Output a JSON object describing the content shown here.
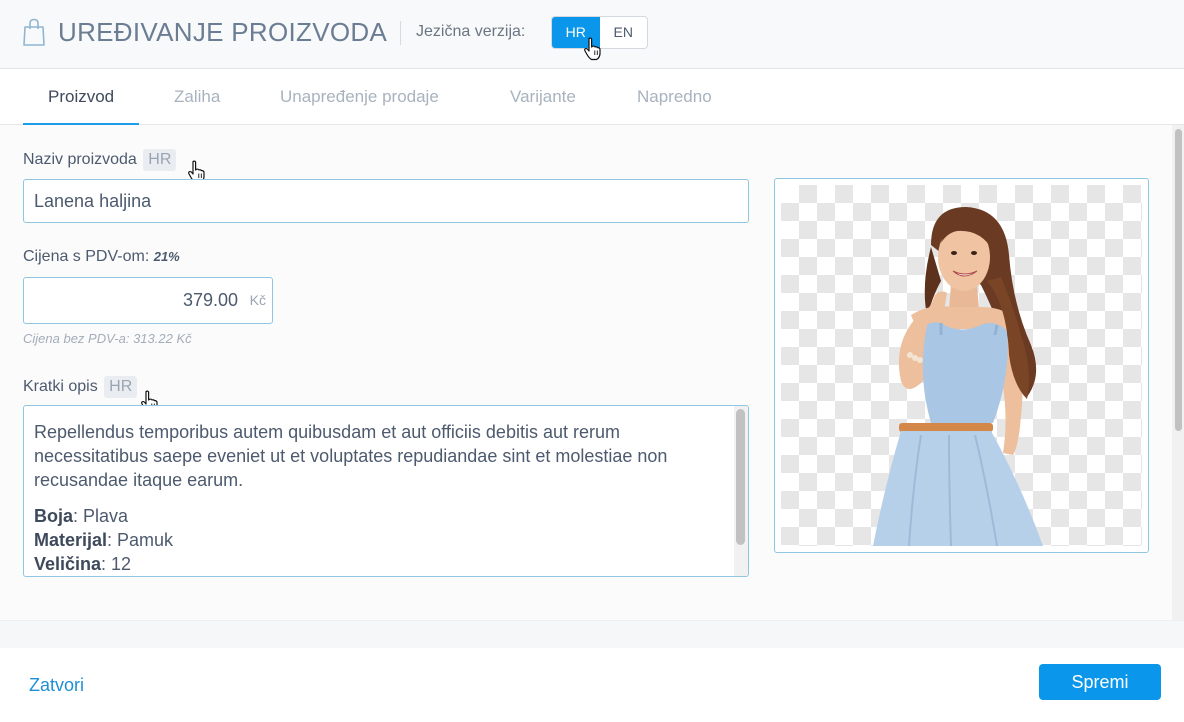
{
  "header": {
    "title": "UREĐIVANJE PROIZVODA",
    "language_label": "Jezična verzija:",
    "languages": [
      {
        "code": "HR",
        "active": true
      },
      {
        "code": "EN",
        "active": false
      }
    ]
  },
  "tabs": [
    {
      "label": "Proizvod",
      "active": true
    },
    {
      "label": "Zaliha",
      "active": false
    },
    {
      "label": "Unapređenje prodaje",
      "active": false
    },
    {
      "label": "Varijante",
      "active": false
    },
    {
      "label": "Napredno",
      "active": false
    }
  ],
  "form": {
    "name_label": "Naziv proizvoda",
    "name_lang_chip": "HR",
    "name_value": "Lanena haljina",
    "price_label": "Cijena s PDV-om:",
    "vat_rate": "21%",
    "price_value": "379.00",
    "currency": "Kč",
    "price_hint": "Cijena bez PDV-a: 313.22 Kč",
    "desc_label": "Kratki opis",
    "desc_lang_chip": "HR",
    "desc_paragraph": "Repellendus temporibus autem quibusdam et aut officiis debitis aut rerum necessitatibus saepe eveniet ut et voluptates repudiandae sint et molestiae non recusandae itaque earum.",
    "attributes": [
      {
        "name": "Boja",
        "value": ": Plava"
      },
      {
        "name": "Materijal",
        "value": ": Pamuk"
      },
      {
        "name": "Veličina",
        "value": ": 12"
      }
    ]
  },
  "footer": {
    "close_label": "Zatvori",
    "save_label": "Spremi"
  },
  "colors": {
    "accent": "#0a96ea",
    "link": "#1f8fd6",
    "input_border": "#8fc6e4"
  }
}
